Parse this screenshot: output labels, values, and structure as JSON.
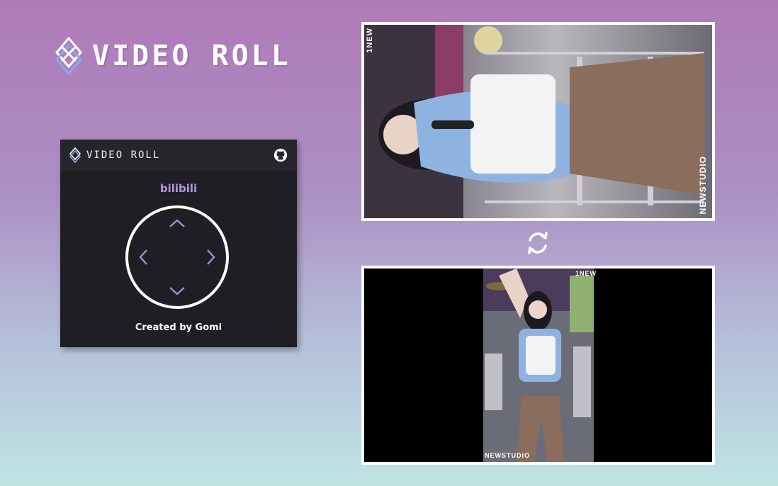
{
  "hero": {
    "title": "VIDEO ROLL"
  },
  "popup": {
    "brand_title": "VIDEO ROLL",
    "site": "bilibili",
    "credit": "Created by Gomi",
    "controls": [
      "up",
      "down",
      "left",
      "right"
    ]
  },
  "videos": {
    "top": {
      "watermark_1": "1NEW",
      "watermark_2": "NEWSTUDIO",
      "orientation": "rotated"
    },
    "bottom": {
      "watermark_1": "1NEW",
      "watermark_2": "NEWSTUDIO",
      "orientation": "original"
    }
  },
  "icons": {
    "logo": "video-roll-logo-icon",
    "github": "github-icon",
    "refresh": "refresh-icon",
    "arrows": [
      "chevron-up-icon",
      "chevron-down-icon",
      "chevron-left-icon",
      "chevron-right-icon"
    ]
  },
  "colors": {
    "accent": "#b49ae0",
    "panel": "#1e1e24",
    "gradient_top": "#b07ab8",
    "gradient_bottom": "#bfe4e3"
  }
}
